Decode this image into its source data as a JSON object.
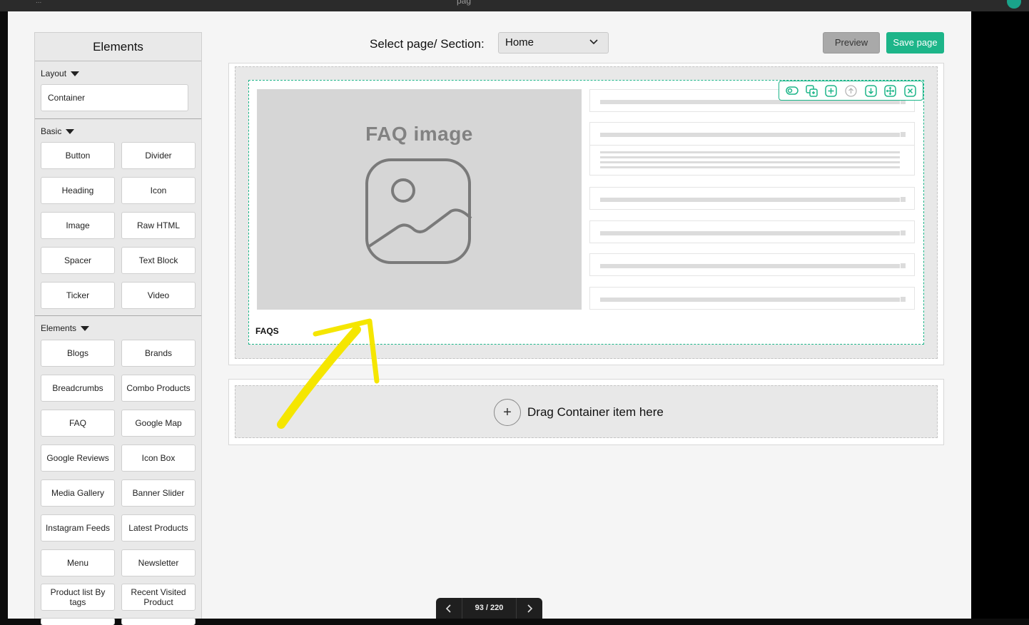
{
  "window": {
    "title_fragment": "pag",
    "left_fragment": "..."
  },
  "sidebar": {
    "title": "Elements",
    "sections": {
      "layout": {
        "label": "Layout",
        "items": [
          "Container"
        ]
      },
      "basic": {
        "label": "Basic",
        "items": [
          "Button",
          "Divider",
          "Heading",
          "Icon",
          "Image",
          "Raw HTML",
          "Spacer",
          "Text Block",
          "Ticker",
          "Video"
        ]
      },
      "elements": {
        "label": "Elements",
        "items": [
          "Blogs",
          "Brands",
          "Breadcrumbs",
          "Combo Products",
          "FAQ",
          "Google Map",
          "Google Reviews",
          "Icon Box",
          "Media Gallery",
          "Banner Slider",
          "Instagram Feeds",
          "Latest Products",
          "Menu",
          "Newsletter",
          "Product list By tags",
          "Recent Visited Product"
        ]
      }
    }
  },
  "header": {
    "select_label": "Select page/ Section:",
    "select_value": "Home",
    "preview_label": "Preview",
    "save_label": "Save page"
  },
  "faq_block": {
    "image_title": "FAQ image",
    "label": "FAQS",
    "toolbar_icons": [
      "toggle-icon",
      "duplicate-icon",
      "add-icon",
      "move-up-icon",
      "move-down-icon",
      "drag-icon",
      "close-icon"
    ]
  },
  "dropzone": {
    "text": "Drag Container item here"
  },
  "pager": {
    "text": "93 / 220"
  },
  "colors": {
    "accent": "#1db589",
    "annotation": "#f5e600"
  }
}
